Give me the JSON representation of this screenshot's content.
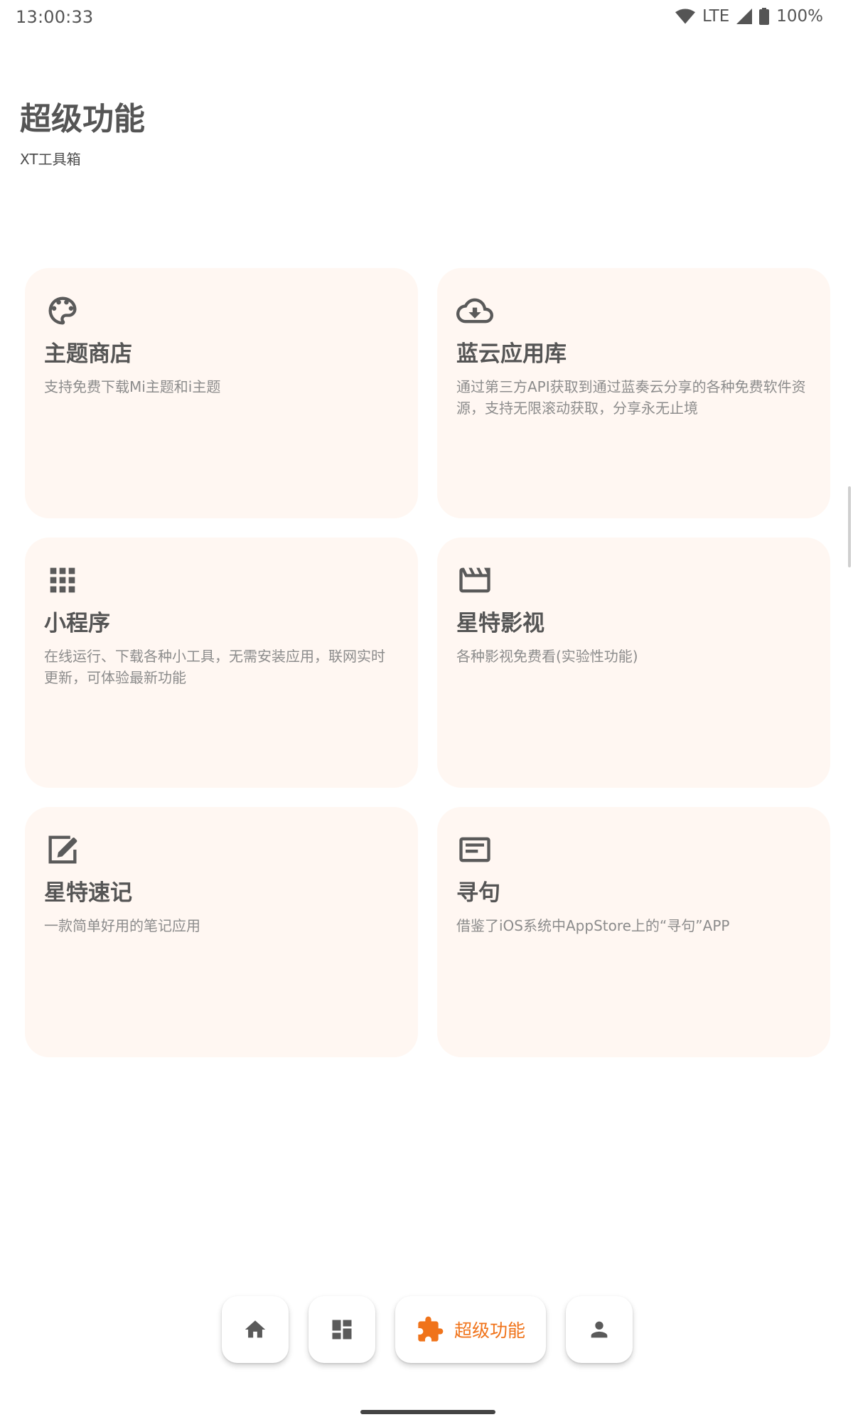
{
  "status_bar": {
    "time": "13:00:33",
    "network": "LTE",
    "battery": "100%"
  },
  "header": {
    "title": "超级功能",
    "subtitle": "XT工具箱"
  },
  "cards": [
    {
      "icon": "palette-icon",
      "title": "主题商店",
      "description": "支持免费下载Mi主题和i主题"
    },
    {
      "icon": "cloud-download-icon",
      "title": "蓝云应用库",
      "description": "通过第三方API获取到通过蓝奏云分享的各种免费软件资源，支持无限滚动获取，分享永无止境"
    },
    {
      "icon": "apps-grid-icon",
      "title": "小程序",
      "description": "在线运行、下载各种小工具，无需安装应用，联网实时更新，可体验最新功能"
    },
    {
      "icon": "movie-clapper-icon",
      "title": "星特影视",
      "description": "各种影视免费看(实验性功能)"
    },
    {
      "icon": "edit-note-icon",
      "title": "星特速记",
      "description": "一款简单好用的笔记应用"
    },
    {
      "icon": "article-icon",
      "title": "寻句",
      "description": "借鉴了iOS系统中AppStore上的“寻句”APP"
    }
  ],
  "bottom_nav": {
    "items": [
      {
        "icon": "home-icon"
      },
      {
        "icon": "dashboard-icon"
      },
      {
        "icon": "puzzle-icon",
        "label": "超级功能",
        "active": true
      },
      {
        "icon": "person-icon"
      }
    ]
  },
  "colors": {
    "accent": "#f0731a",
    "card_background": "#fff7f2",
    "icon": "#5a5a5a"
  }
}
